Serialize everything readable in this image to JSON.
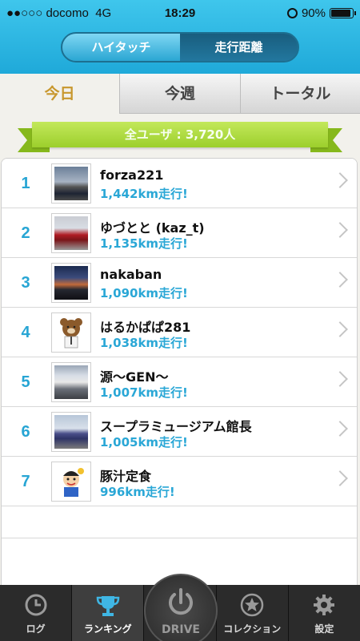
{
  "status": {
    "carrier": "●●○○○ docomo",
    "network": "4G",
    "time": "18:29",
    "battery": "90%"
  },
  "segmented": {
    "left": "ハイタッチ",
    "right": "走行距離"
  },
  "tabs": [
    "今日",
    "今週",
    "トータル"
  ],
  "ribbon": "全ユーザ : 3,720人",
  "rows": [
    {
      "rank": "1",
      "name": "forza221",
      "distance": "1,442km走行!",
      "icon": "car-photo"
    },
    {
      "rank": "2",
      "name": "ゆづとと (kaz_t)",
      "distance": "1,135km走行!",
      "icon": "car-photo"
    },
    {
      "rank": "3",
      "name": "nakaban",
      "distance": "1,090km走行!",
      "icon": "sunset-photo"
    },
    {
      "rank": "4",
      "name": "はるかぱぱ281",
      "distance": "1,038km走行!",
      "icon": "bear-avatar"
    },
    {
      "rank": "5",
      "name": "源〜GEN〜",
      "distance": "1,007km走行!",
      "icon": "truck-photo"
    },
    {
      "rank": "6",
      "name": "スープラミュージアム館長",
      "distance": "1,005km走行!",
      "icon": "car-photo"
    },
    {
      "rank": "7",
      "name": "豚汁定食",
      "distance": "996km走行!",
      "icon": "cartoon-avatar"
    }
  ],
  "bottom_nav": {
    "log": "ログ",
    "ranking": "ランキング",
    "drive": "DRIVE",
    "collection": "コレクション",
    "settings": "設定"
  },
  "colors": {
    "accent": "#27a5d4",
    "ribbon": "#a6d435",
    "tab_active_text": "#c8972d"
  }
}
